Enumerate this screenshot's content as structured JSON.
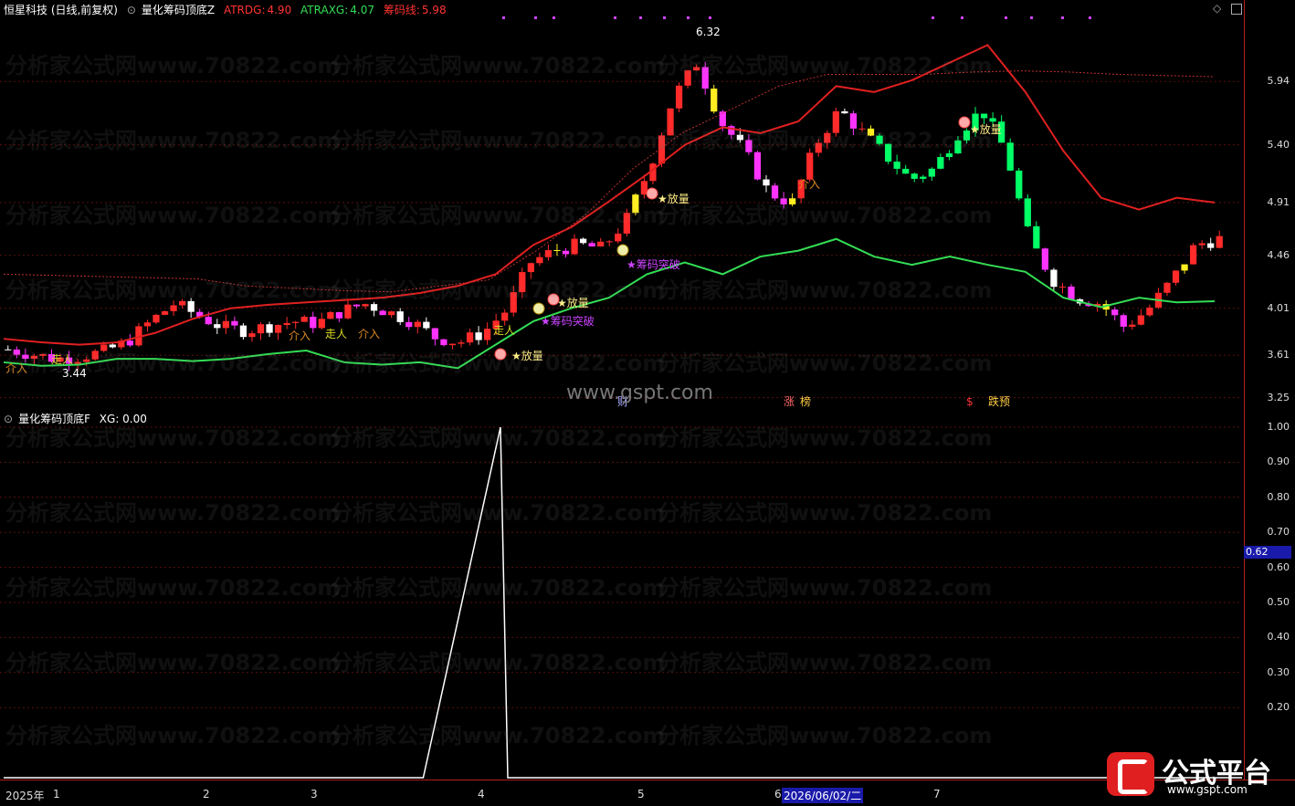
{
  "top": {
    "name": "恒星科技 (日线,前复权)",
    "indicator": "量化筹码顶底Z",
    "atrdg_label": "ATRDG:",
    "atrdg_val": "4.90",
    "atraxg_label": "ATRAXG:",
    "atraxg_val": "4.07",
    "cml_label": "筹码线:",
    "cml_val": "5.98",
    "gsp": "www.gspt.com",
    "high_label": "6.32",
    "low_label": "3.44",
    "y_ticks": [
      "5.94",
      "5.40",
      "4.91",
      "4.46",
      "4.01",
      "3.61",
      "3.25"
    ]
  },
  "bottom": {
    "indicator": "量化筹码顶底F",
    "xg": "XG: 0.00",
    "y_ticks": [
      "1.00",
      "0.90",
      "0.80",
      "0.70",
      "0.60",
      "0.50",
      "0.40",
      "0.30",
      "0.20"
    ],
    "cursor_value": "0.62"
  },
  "x_axis": {
    "year": "2025年",
    "months": [
      "1",
      "2",
      "3",
      "4",
      "5",
      "6",
      "7"
    ],
    "cursor_date": "2026/06/02/二"
  },
  "watermark": "分析家公式网www.70822.com",
  "logo": {
    "text": "公式平台",
    "url": "www.gspt.com"
  },
  "colors": {
    "up": "#ff2a2a",
    "down": "#00ff66",
    "magenta": "#ff33ff",
    "yellow": "#ffee22",
    "white": "#ffffff",
    "green_line": "#33dd55",
    "red_line": "#e02020"
  },
  "chart_data": [
    {
      "type": "candlestick",
      "annotations": [
        "介入",
        "走人",
        "★放量",
        "★筹码突破",
        "涨",
        "榜",
        "财",
        "$",
        "跌预"
      ],
      "y_ticks": [
        5.94,
        5.4,
        4.91,
        4.46,
        4.01,
        3.61,
        3.25
      ],
      "ylim": [
        3.2,
        6.4
      ],
      "series": [
        {
          "name": "ATRDG",
          "values": [
            3.75,
            3.72,
            3.7,
            3.72,
            3.8,
            3.92,
            4.01,
            4.04,
            4.06,
            4.08,
            4.1,
            4.14,
            4.2,
            4.3,
            4.55,
            4.7,
            4.92,
            5.15,
            5.4,
            5.55,
            5.5,
            5.6,
            5.9,
            5.85,
            5.95,
            6.1,
            6.25,
            5.85,
            5.35,
            4.95,
            4.85,
            4.95,
            4.91
          ]
        },
        {
          "name": "ATRAXG",
          "values": [
            3.55,
            3.52,
            3.53,
            3.58,
            3.58,
            3.56,
            3.58,
            3.62,
            3.65,
            3.55,
            3.53,
            3.55,
            3.5,
            3.7,
            3.9,
            4.01,
            4.1,
            4.3,
            4.4,
            4.3,
            4.45,
            4.5,
            4.6,
            4.45,
            4.38,
            4.45,
            4.38,
            4.32,
            4.1,
            4.02,
            4.1,
            4.06,
            4.07
          ]
        },
        {
          "name": "筹码线",
          "values": [
            4.3,
            4.29,
            4.28,
            4.27,
            4.26,
            4.2,
            4.18,
            4.16,
            4.15,
            4.2,
            4.25,
            4.5,
            4.8,
            5.2,
            5.5,
            5.7,
            5.9,
            6.0,
            6.0,
            6.0,
            6.02,
            6.03,
            6.02,
            6.0,
            5.99,
            5.98
          ]
        }
      ]
    },
    {
      "type": "line",
      "series": [
        {
          "name": "XG",
          "values": [
            0,
            0,
            0,
            0,
            0,
            0,
            0,
            1,
            0,
            0,
            0,
            0,
            0,
            0,
            0,
            0,
            0,
            0,
            0,
            0
          ]
        }
      ],
      "y_ticks": [
        1.0,
        0.9,
        0.8,
        0.7,
        0.6,
        0.5,
        0.4,
        0.3,
        0.2
      ],
      "ylim": [
        0,
        1.0
      ]
    }
  ]
}
